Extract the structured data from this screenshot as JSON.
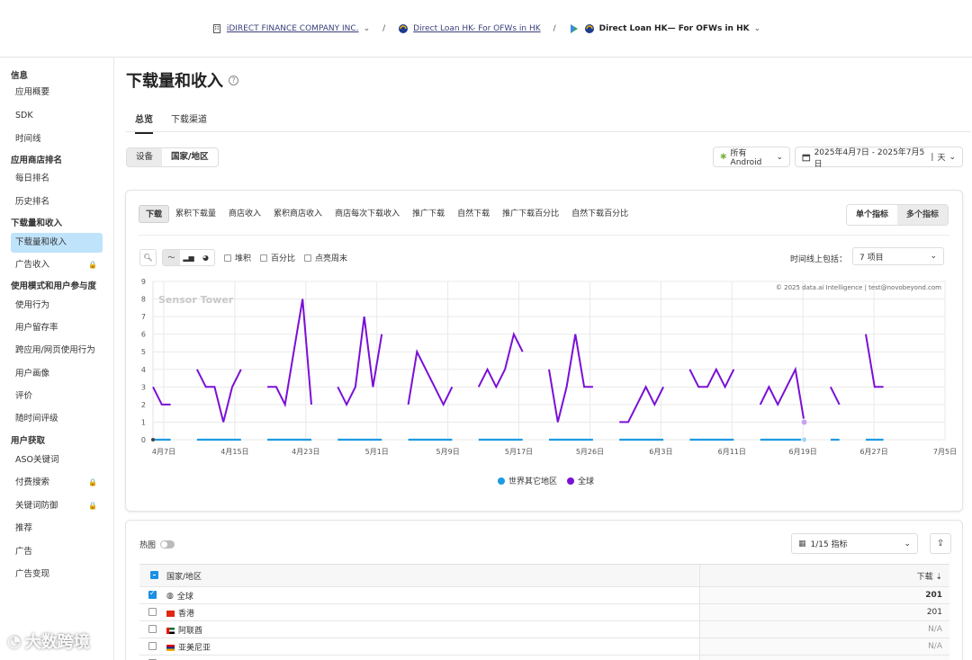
{
  "breadcrumb": {
    "company": "iDIRECT FINANCE COMPANY INC.",
    "app_ios": "Direct Loan HK- For OFWs in HK",
    "app_android": "Direct Loan HK— For OFWs in HK",
    "separator": "/"
  },
  "sidebar": {
    "groups": [
      {
        "label": "信息",
        "items": [
          {
            "label": "应用概要"
          },
          {
            "label": "SDK"
          },
          {
            "label": "时间线"
          }
        ]
      },
      {
        "label": "应用商店排名",
        "items": [
          {
            "label": "每日排名"
          },
          {
            "label": "历史排名"
          }
        ]
      },
      {
        "label": "下载量和收入",
        "items": [
          {
            "label": "下载量和收入",
            "active": true
          },
          {
            "label": "广告收入",
            "locked": true
          }
        ]
      },
      {
        "label": "使用模式和用户参与度",
        "items": [
          {
            "label": "使用行为"
          },
          {
            "label": "用户留存率"
          },
          {
            "label": "跨应用/网页使用行为"
          },
          {
            "label": "用户画像"
          },
          {
            "label": "评价"
          },
          {
            "label": "随时间评级"
          }
        ]
      },
      {
        "label": "用户获取",
        "items": [
          {
            "label": "ASO关键词"
          },
          {
            "label": "付费搜索",
            "locked": true
          },
          {
            "label": "关键词防御",
            "locked": true
          },
          {
            "label": "推荐"
          },
          {
            "label": "广告"
          },
          {
            "label": "广告变现"
          }
        ]
      }
    ]
  },
  "page": {
    "title": "下载量和收入",
    "tabs": [
      "总览",
      "下载渠道"
    ]
  },
  "filters": {
    "segment": [
      "设备",
      "国家/地区"
    ],
    "platform": "所有Android",
    "date_range": "2025年4月7日 - 2025年7月5日",
    "granularity": "天"
  },
  "metrics": {
    "tabs": [
      "下载",
      "累积下载量",
      "商店收入",
      "累积商店收入",
      "商店每次下载收入",
      "推广下载",
      "自然下载",
      "推广下载百分比",
      "自然下载百分比"
    ],
    "active": "下载",
    "mode": [
      "单个指标",
      "多个指标"
    ]
  },
  "toolbar": {
    "options": [
      "堆积",
      "百分比",
      "点亮周末"
    ],
    "timeline_label": "时间线上包括：",
    "timeline_value": "7 项目"
  },
  "chart_data": {
    "type": "line",
    "title": "",
    "x_tick_labels": [
      "4月7日",
      "4月15日",
      "4月23日",
      "5月1日",
      "5月9日",
      "5月17日",
      "5月26日",
      "6月3日",
      "6月11日",
      "6月19日",
      "6月27日",
      "7月5日"
    ],
    "ylim": [
      0,
      9
    ],
    "y_ticks": [
      0,
      1,
      2,
      3,
      4,
      5,
      6,
      7,
      8,
      9
    ],
    "watermark": "Sensor Tower",
    "copyright": "© 2025 data.ai Intelligence | test@novobeyond.com",
    "series": [
      {
        "name": "全球",
        "color": "#7a10d6",
        "values": [
          3,
          2,
          2,
          null,
          null,
          4,
          3,
          3,
          1,
          3,
          4,
          null,
          null,
          3,
          3,
          2,
          5,
          8,
          2,
          null,
          null,
          3,
          2,
          3,
          7,
          3,
          6,
          null,
          null,
          2,
          5,
          4,
          3,
          2,
          3,
          null,
          null,
          3,
          4,
          3,
          4,
          6,
          5,
          null,
          null,
          4,
          1,
          3,
          6,
          3,
          3,
          null,
          null,
          1,
          1,
          2,
          3,
          2,
          3,
          null,
          null,
          4,
          3,
          3,
          4,
          3,
          4,
          null,
          null,
          2,
          3,
          2,
          3,
          4,
          1,
          null,
          null,
          3,
          2,
          null,
          null,
          6,
          3,
          3,
          null,
          null,
          null,
          null,
          null,
          null,
          null
        ]
      },
      {
        "name": "世界其它地区",
        "color": "#1e9be3",
        "values": [
          0,
          0,
          0,
          null,
          null,
          0,
          0,
          0,
          0,
          0,
          0,
          null,
          null,
          0,
          0,
          0,
          0,
          0,
          0,
          null,
          null,
          0,
          0,
          0,
          0,
          0,
          0,
          null,
          null,
          0,
          0,
          0,
          0,
          0,
          0,
          null,
          null,
          0,
          0,
          0,
          0,
          0,
          0,
          null,
          null,
          0,
          0,
          0,
          0,
          0,
          0,
          null,
          null,
          0,
          0,
          0,
          0,
          0,
          0,
          null,
          null,
          0,
          0,
          0,
          0,
          0,
          0,
          null,
          null,
          0,
          0,
          0,
          0,
          0,
          0,
          null,
          null,
          0,
          0,
          null,
          null,
          0,
          0,
          0,
          null,
          null,
          null,
          null,
          null,
          null,
          null
        ]
      }
    ],
    "legend": [
      "世界其它地区",
      "全球"
    ],
    "legend_position": "bottom-center"
  },
  "table": {
    "heatmap_label": "热图",
    "indicator_dd": "1/15 指标",
    "headers": {
      "country": "国家/地区",
      "value": "下载"
    },
    "rows": [
      {
        "name": "全球",
        "flag": "globe",
        "checked": true,
        "value": "201",
        "bold": true
      },
      {
        "name": "香港",
        "flag": "hk",
        "checked": false,
        "value": "201"
      },
      {
        "name": "阿联酋",
        "flag": "ae",
        "checked": false,
        "value": "N/A"
      },
      {
        "name": "亚美尼亚",
        "flag": "am",
        "checked": false,
        "value": "N/A"
      },
      {
        "name": "",
        "flag": "",
        "checked": false,
        "value": ""
      }
    ]
  },
  "watermark_text": "大数跨境"
}
